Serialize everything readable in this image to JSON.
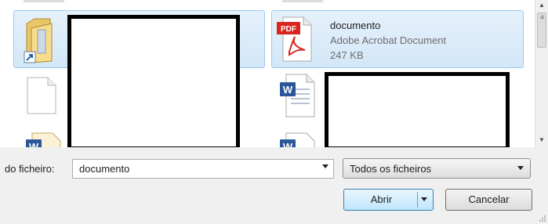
{
  "file_list": {
    "items": [
      {
        "kind": "folder-shortcut",
        "selected": true
      },
      {
        "kind": "pdf",
        "selected": true,
        "name": "documento",
        "type": "Adobe Acrobat Document",
        "size": "247 KB"
      },
      {
        "kind": "blank-file",
        "selected": false
      },
      {
        "kind": "word-document",
        "selected": false
      },
      {
        "kind": "word-document",
        "selected": false
      },
      {
        "kind": "word-document",
        "selected": false
      }
    ]
  },
  "filename": {
    "label": "do ficheiro:",
    "value": "documento"
  },
  "file_type": {
    "selected": "Todos os ficheiros"
  },
  "buttons": {
    "open": "Abrir",
    "cancel": "Cancelar"
  },
  "icons": {
    "pdf_badge": "PDF",
    "word_badge": "W"
  },
  "colors": {
    "selection_fill": "#dbeaf9",
    "selection_border": "#9ec9ee",
    "pdf_red": "#d9261c",
    "word_blue": "#2b579a"
  }
}
